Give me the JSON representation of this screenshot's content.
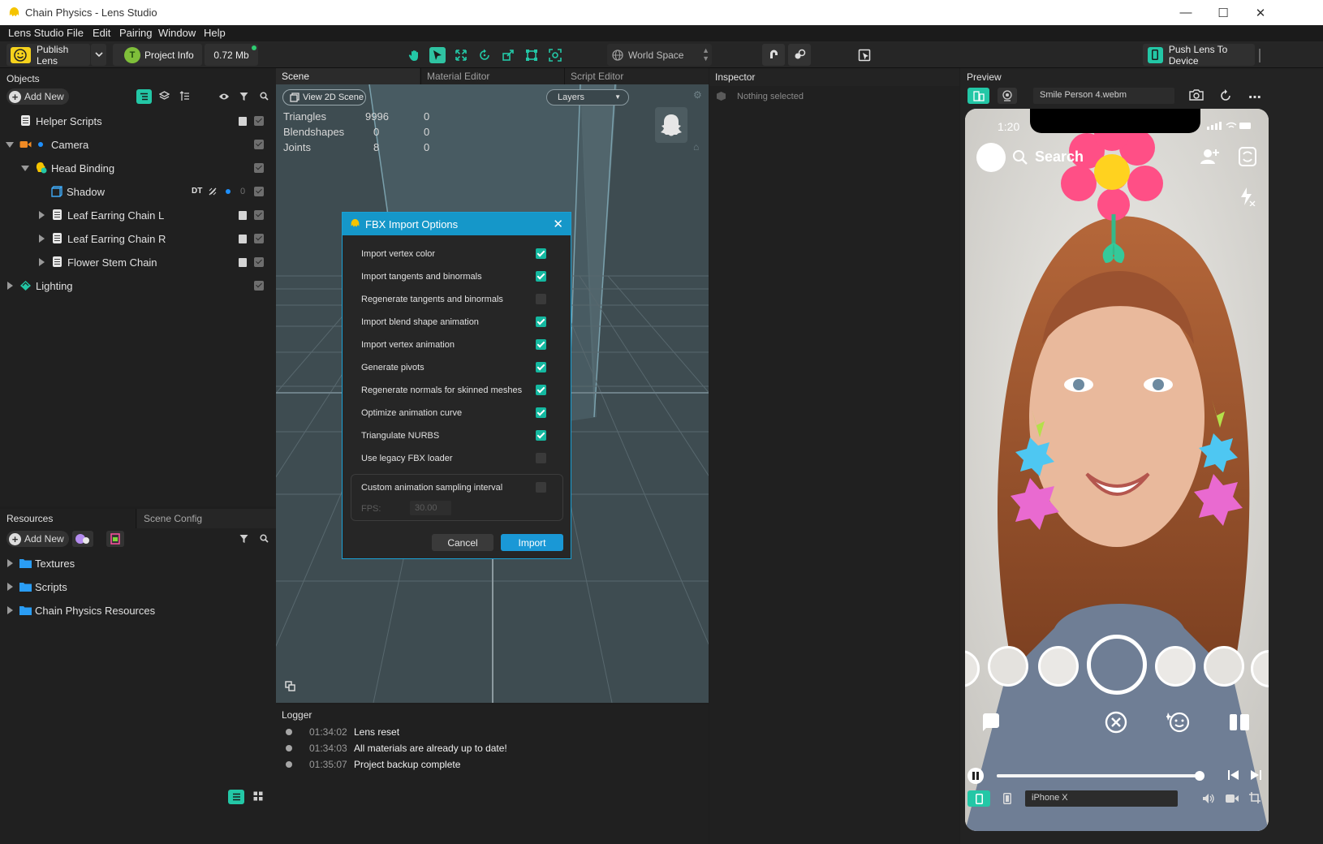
{
  "window": {
    "title": "Chain Physics - Lens Studio"
  },
  "menu": [
    "Lens Studio",
    "File",
    "Edit",
    "Pairing",
    "Window",
    "Help"
  ],
  "toolbar": {
    "publish_label": "Publish Lens",
    "project_info_label": "Project Info",
    "size_label": "0.72 Mb",
    "space_label": "World Space",
    "push_label": "Push Lens To Device"
  },
  "objects": {
    "title": "Objects",
    "add_new": "Add New",
    "items": [
      {
        "label": "Helper Scripts"
      },
      {
        "label": "Camera"
      },
      {
        "label": "Head Binding"
      },
      {
        "label": "Shadow",
        "badge": "DT",
        "count": "0"
      },
      {
        "label": "Leaf Earring Chain L"
      },
      {
        "label": "Leaf Earring Chain R"
      },
      {
        "label": "Flower Stem Chain"
      },
      {
        "label": "Lighting"
      }
    ]
  },
  "resources": {
    "tab_resources": "Resources",
    "tab_scene_config": "Scene Config",
    "add_new": "Add New",
    "items": [
      {
        "label": "Textures"
      },
      {
        "label": "Scripts"
      },
      {
        "label": "Chain Physics Resources"
      }
    ]
  },
  "scene": {
    "tabs": [
      "Scene",
      "Material Editor",
      "Script Editor"
    ],
    "view_2d_label": "View 2D Scene",
    "layers_label": "Layers",
    "stats": [
      {
        "label": "Triangles",
        "value": "9996",
        "extra": "0"
      },
      {
        "label": "Blendshapes",
        "value": "0",
        "extra": "0"
      },
      {
        "label": "Joints",
        "value": "8",
        "extra": "0"
      }
    ]
  },
  "dialog": {
    "title": "FBX Import Options",
    "options": [
      {
        "label": "Import vertex color",
        "checked": true
      },
      {
        "label": "Import tangents and binormals",
        "checked": true
      },
      {
        "label": "Regenerate tangents and binormals",
        "checked": false
      },
      {
        "label": "Import blend shape animation",
        "checked": true
      },
      {
        "label": "Import vertex animation",
        "checked": true
      },
      {
        "label": "Generate pivots",
        "checked": true
      },
      {
        "label": "Regenerate normals for skinned meshes",
        "checked": true
      },
      {
        "label": "Optimize animation curve",
        "checked": true
      },
      {
        "label": "Triangulate NURBS",
        "checked": true
      },
      {
        "label": "Use legacy FBX loader",
        "checked": false
      }
    ],
    "custom_sampling_label": "Custom animation sampling interval",
    "custom_sampling_checked": false,
    "fps_label": "FPS:",
    "fps_value": "30.00",
    "cancel_label": "Cancel",
    "import_label": "Import"
  },
  "inspector": {
    "title": "Inspector",
    "empty_label": "Nothing selected"
  },
  "logger": {
    "title": "Logger",
    "entries": [
      {
        "time": "01:34:02",
        "message": "Lens reset"
      },
      {
        "time": "01:34:03",
        "message": "All materials are already up to date!"
      },
      {
        "time": "01:35:07",
        "message": "Project backup complete"
      }
    ]
  },
  "preview": {
    "title": "Preview",
    "video_name": "Smile Person 4.webm",
    "phone_time": "1:20",
    "search_label": "Search",
    "device_label": "iPhone X",
    "playback_progress": 0.98
  }
}
